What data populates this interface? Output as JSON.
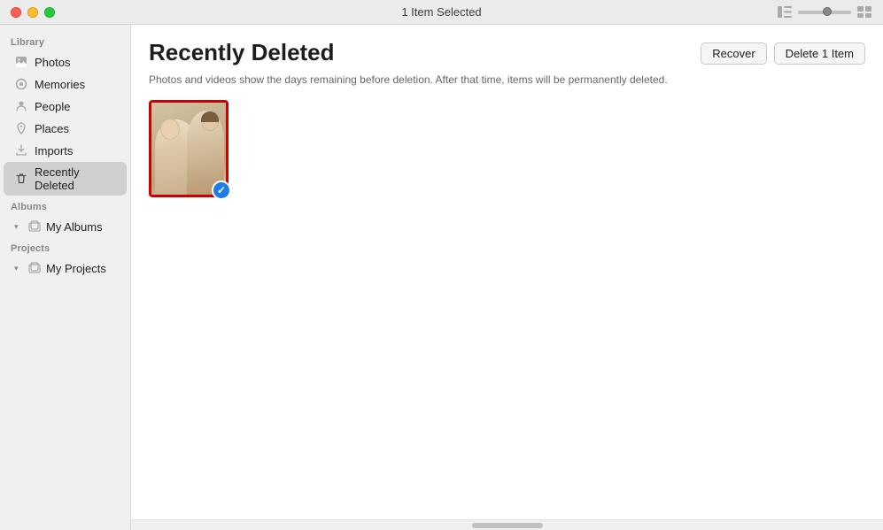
{
  "titlebar": {
    "title": "1 Item Selected",
    "buttons": {
      "close": "close",
      "minimize": "minimize",
      "maximize": "maximize"
    }
  },
  "sidebar": {
    "library_label": "Library",
    "items": [
      {
        "id": "photos",
        "label": "Photos",
        "icon": "photos"
      },
      {
        "id": "memories",
        "label": "Memories",
        "icon": "memories"
      },
      {
        "id": "people",
        "label": "People",
        "icon": "people"
      },
      {
        "id": "places",
        "label": "Places",
        "icon": "places"
      },
      {
        "id": "imports",
        "label": "Imports",
        "icon": "imports"
      },
      {
        "id": "recently-deleted",
        "label": "Recently Deleted",
        "icon": "trash",
        "active": true
      }
    ],
    "albums_label": "Albums",
    "albums_items": [
      {
        "id": "my-albums",
        "label": "My Albums",
        "icon": "album"
      }
    ],
    "projects_label": "Projects",
    "projects_items": [
      {
        "id": "my-projects",
        "label": "My Projects",
        "icon": "projects"
      }
    ]
  },
  "main": {
    "title": "Recently Deleted",
    "subtitle": "Photos and videos show the days remaining before deletion. After that time, items will be permanently deleted.",
    "recover_button": "Recover",
    "delete_button": "Delete 1 Item"
  }
}
